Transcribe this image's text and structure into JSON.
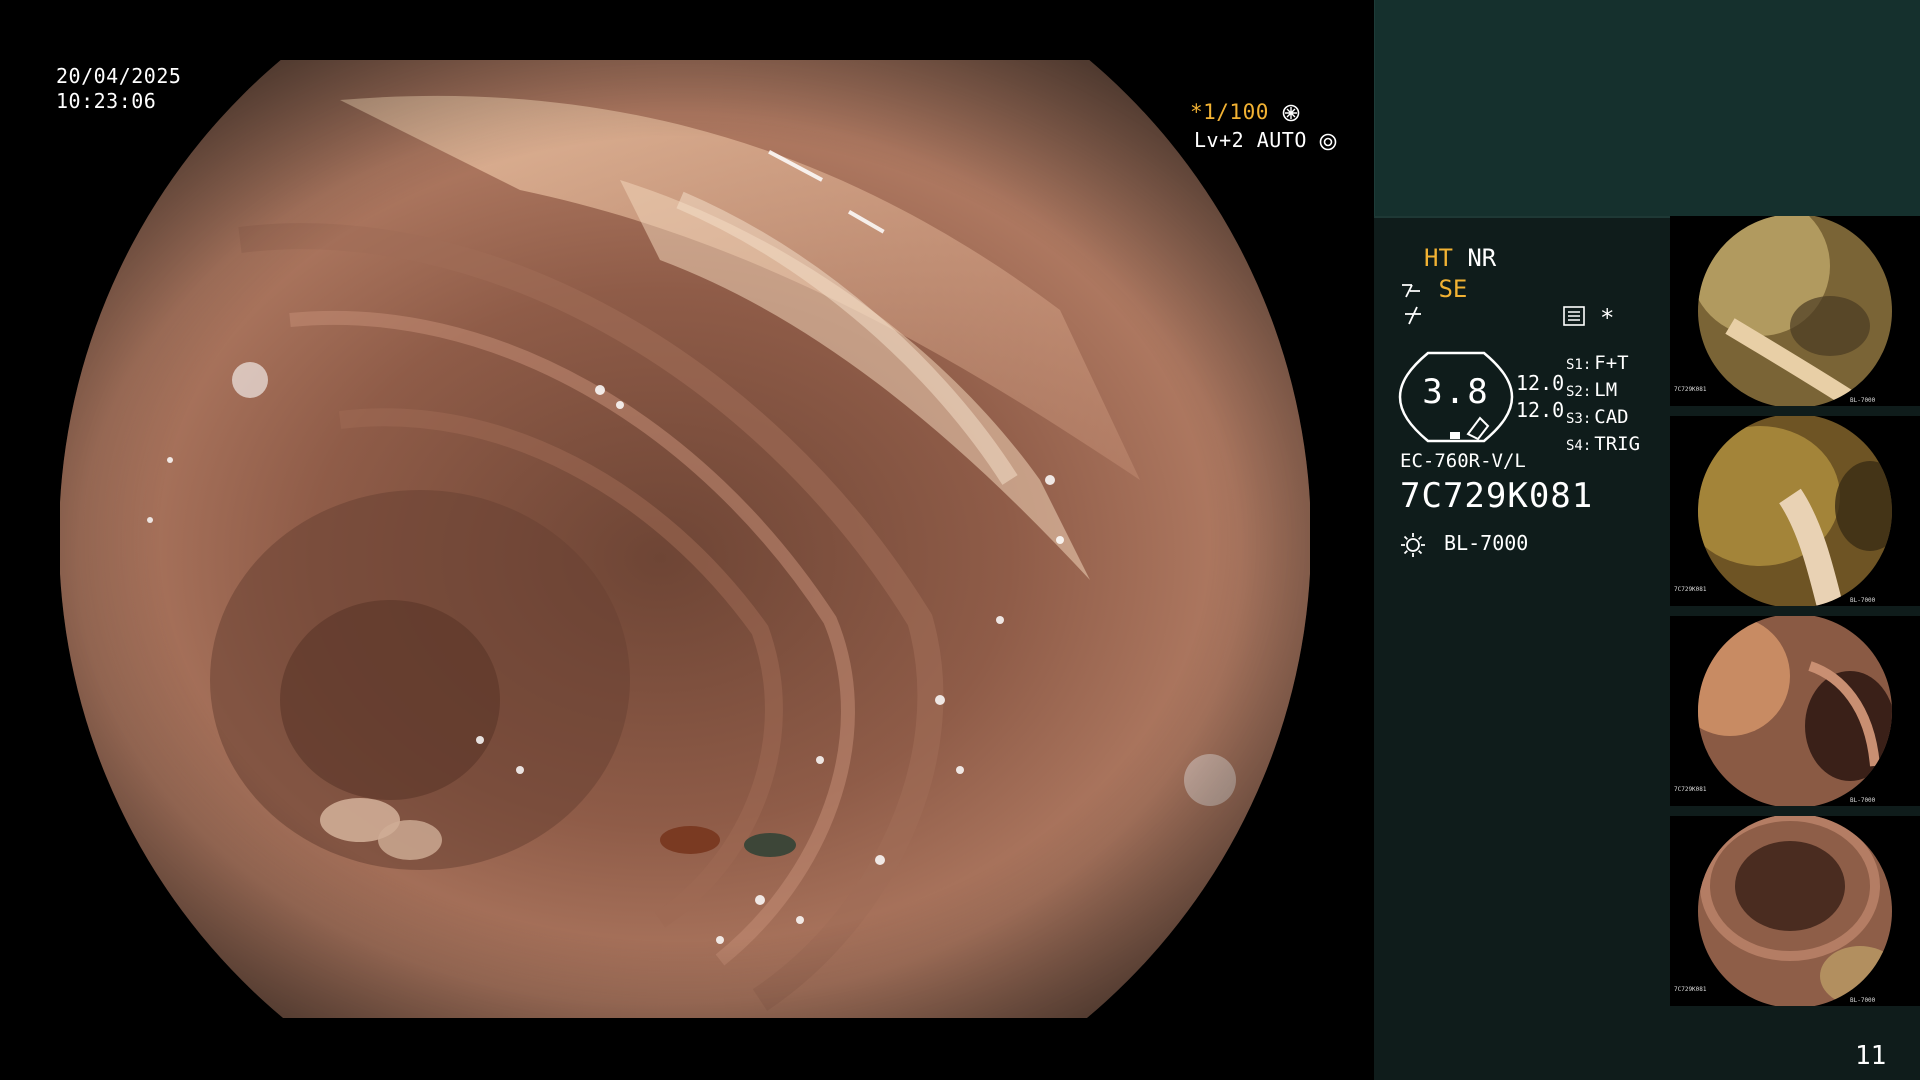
{
  "overlay": {
    "date": "20/04/2025",
    "time": "10:23:06",
    "shutter": "*1/100",
    "level": "Lv+2 AUTO"
  },
  "panel": {
    "ht_label": "HT",
    "nr_label": "NR",
    "se_label": "SE",
    "star_label": "*",
    "gauge_value": "3.8",
    "value_1": "12.0",
    "value_2": "12.0",
    "slots": [
      {
        "key": "S1:",
        "value": "F+T"
      },
      {
        "key": "S2:",
        "value": "LM"
      },
      {
        "key": "S3:",
        "value": "CAD"
      },
      {
        "key": "S4:",
        "value": "TRIG"
      }
    ],
    "scope_model": "EC-760R-V/L",
    "scope_serial": "7C729K081",
    "light_source": "BL-7000",
    "page_number": "11"
  },
  "thumbnails": [
    {
      "serial": "7C729K081",
      "light": "BL-7000"
    },
    {
      "serial": "7C729K081",
      "light": "BL-7000"
    },
    {
      "serial": "7C729K081",
      "light": "BL-7000"
    },
    {
      "serial": "7C729K081",
      "light": "BL-7000"
    }
  ],
  "colors": {
    "accent_yellow": "#f2b233",
    "panel_bg": "#0f1c1b",
    "panel_top": "#15302d",
    "tissue": "#b07a62"
  },
  "icons": [
    "shutter-mode-icon",
    "auto-iris-icon",
    "structure-enhance-icon",
    "freeze-icon",
    "menu-icon",
    "lamp-icon"
  ]
}
